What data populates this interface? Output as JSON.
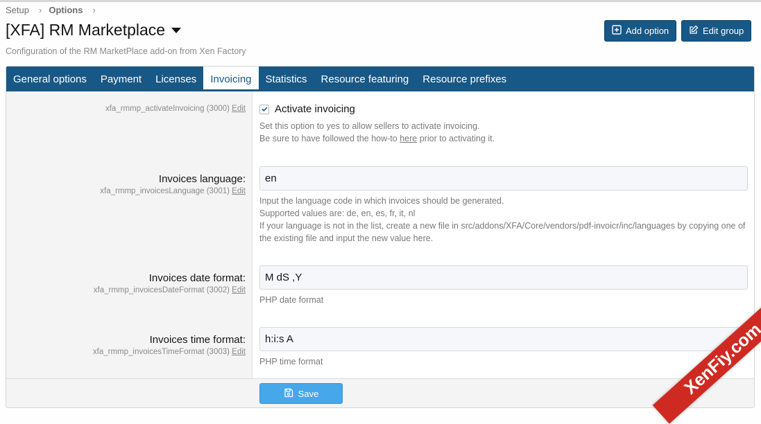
{
  "breadcrumb": {
    "items": [
      "Setup",
      "Options"
    ]
  },
  "page": {
    "title": "[XFA] RM Marketplace",
    "description": "Configuration of the RM MarketPlace add-on from Xen Factory"
  },
  "actions": {
    "add_option": "Add option",
    "edit_group": "Edit group"
  },
  "tabs": [
    {
      "label": "General options",
      "active": false
    },
    {
      "label": "Payment",
      "active": false
    },
    {
      "label": "Licenses",
      "active": false
    },
    {
      "label": "Invoicing",
      "active": true
    },
    {
      "label": "Statistics",
      "active": false
    },
    {
      "label": "Resource featuring",
      "active": false
    },
    {
      "label": "Resource prefixes",
      "active": false
    }
  ],
  "options": {
    "activate": {
      "id": "xfa_rmmp_activateInvoicing (3000)",
      "edit": "Edit",
      "checkbox_label": "Activate invoicing",
      "checked": true,
      "hint1": "Set this option to yes to allow sellers to activate invoicing.",
      "hint2_pre": "Be sure to have followed the how-to ",
      "hint2_link": "here",
      "hint2_post": " prior to activating it."
    },
    "language": {
      "label": "Invoices language:",
      "id": "xfa_rmmp_invoicesLanguage (3001)",
      "edit": "Edit",
      "value": "en",
      "hint1": "Input the language code in which invoices should be generated.",
      "hint2": "Supported values are: de, en, es, fr, it, nl",
      "hint3": "If your language is not in the list, create a new file in src/addons/XFA/Core/vendors/pdf-invoicr/inc/languages by copying one of the existing file and input the new value here."
    },
    "date_format": {
      "label": "Invoices date format:",
      "id": "xfa_rmmp_invoicesDateFormat (3002)",
      "edit": "Edit",
      "value": "M dS ,Y",
      "hint": "PHP date format"
    },
    "time_format": {
      "label": "Invoices time format:",
      "id": "xfa_rmmp_invoicesTimeFormat (3003)",
      "edit": "Edit",
      "value": "h:i:s A",
      "hint": "PHP time format"
    }
  },
  "footer": {
    "save_label": "Save"
  },
  "watermark": {
    "text": "XenFiy.com"
  },
  "colors": {
    "brand": "#185886",
    "save": "#47a7eb",
    "ribbon": "#cf2a22"
  }
}
